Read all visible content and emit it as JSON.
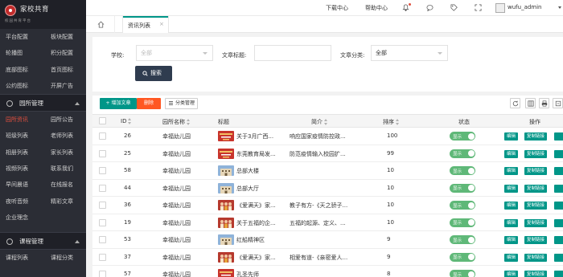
{
  "sidebar": {
    "logo_title": "家校共育",
    "logo_sub": "校园共育平台",
    "top_menu": [
      {
        "label": "平台配置",
        "name": "menu-platform-config"
      },
      {
        "label": "板块配置",
        "name": "menu-section-config"
      },
      {
        "label": "轮播图",
        "name": "menu-carousel"
      },
      {
        "label": "积分配置",
        "name": "menu-points-config"
      },
      {
        "label": "底部图标",
        "name": "menu-bottom-icons"
      },
      {
        "label": "首页图标",
        "name": "menu-home-icons"
      },
      {
        "label": "公约图标",
        "name": "menu-convention-icons"
      },
      {
        "label": "开屏广告",
        "name": "menu-splash-ad"
      }
    ],
    "group1_label": "园所管理",
    "group1_menu": [
      {
        "label": "园所资讯",
        "name": "menu-school-news",
        "active": true
      },
      {
        "label": "园所公告",
        "name": "menu-school-notice"
      },
      {
        "label": "班级列表",
        "name": "menu-class-list"
      },
      {
        "label": "老师列表",
        "name": "menu-teacher-list"
      },
      {
        "label": "相册列表",
        "name": "menu-album-list"
      },
      {
        "label": "家长列表",
        "name": "menu-parent-list"
      },
      {
        "label": "视频列表",
        "name": "menu-video-list"
      },
      {
        "label": "联系我们",
        "name": "menu-contact-us"
      },
      {
        "label": "早间晨语",
        "name": "menu-morning-words"
      },
      {
        "label": "在线报名",
        "name": "menu-online-signup"
      },
      {
        "label": "夜听音频",
        "name": "menu-night-audio"
      },
      {
        "label": "精彩文章",
        "name": "menu-featured-articles"
      },
      {
        "label": "企业理念",
        "name": "menu-company-philosophy"
      }
    ],
    "group2_label": "课程管理",
    "group2_menu": [
      {
        "label": "课程列表",
        "name": "menu-course-list"
      },
      {
        "label": "课程分类",
        "name": "menu-course-category"
      }
    ]
  },
  "header": {
    "download": "下载中心",
    "help": "帮助中心",
    "username": "wufu_admin"
  },
  "tabs": {
    "active_label": "资讯列表",
    "close": "×"
  },
  "filter": {
    "school_label": "学校:",
    "school_value": "全部",
    "title_label": "文章标题:",
    "title_value": "",
    "category_label": "文章分类:",
    "category_value": "全部",
    "search_button": "搜索"
  },
  "toolbar": {
    "add": "+ 增加文章",
    "delete": "删除",
    "category": "分类管理"
  },
  "table": {
    "headers": {
      "id": "ID",
      "school": "园所名称",
      "title": "标题",
      "summary": "简介",
      "order": "排序",
      "status": "状态",
      "ops": "操作"
    },
    "status_label": "显示",
    "edit_label": "编辑",
    "copy_label": "复制链接",
    "rows": [
      {
        "id": "26",
        "school": "幸福幼儿园",
        "title": "关于3月广西...",
        "summary": "响应国家疫情防控政...",
        "order": "100",
        "thumb": "red"
      },
      {
        "id": "25",
        "school": "幸福幼儿园",
        "title": "东莞教育局发...",
        "summary": "防范疫情输入校园扩...",
        "order": "99",
        "thumb": "red"
      },
      {
        "id": "58",
        "school": "幸福幼儿园",
        "title": "总部大楼",
        "summary": "",
        "order": "10",
        "thumb": "bldg"
      },
      {
        "id": "44",
        "school": "幸福幼儿园",
        "title": "总部大厅",
        "summary": "",
        "order": "10",
        "thumb": "bldg"
      },
      {
        "id": "36",
        "school": "幸福幼儿园",
        "title": "《爱满天》家...",
        "summary": "教子有方-《天之骄子...",
        "order": "10",
        "thumb": "kids"
      },
      {
        "id": "19",
        "school": "幸福幼儿园",
        "title": "关于五福的企...",
        "summary": "五福的起源、定义、...",
        "order": "10",
        "thumb": "kids"
      },
      {
        "id": "53",
        "school": "幸福幼儿园",
        "title": "红船精神区",
        "summary": "",
        "order": "9",
        "thumb": "bldg"
      },
      {
        "id": "37",
        "school": "幸福幼儿园",
        "title": "《爱满天》家...",
        "summary": "相爱有道-《亲密爱人...",
        "order": "9",
        "thumb": "kids"
      },
      {
        "id": "57",
        "school": "幸福幼儿园",
        "title": "孔圣先师",
        "summary": "",
        "order": "8",
        "thumb": "red"
      }
    ]
  },
  "icons": {
    "home": "home-icon",
    "bell": "bell-icon",
    "chat": "chat-icon",
    "tag": "tag-icon",
    "fullscreen": "fullscreen-icon",
    "refresh": "refresh-icon",
    "columns": "columns-icon",
    "print": "print-icon",
    "export": "export-icon"
  },
  "colors": {
    "sidebar_bg": "#2b2d35",
    "active_menu": "#e04f3f",
    "primary": "#009688",
    "danger": "#ff5722",
    "search_btn": "#2f3c4f",
    "toggle_on": "#5fb878"
  }
}
